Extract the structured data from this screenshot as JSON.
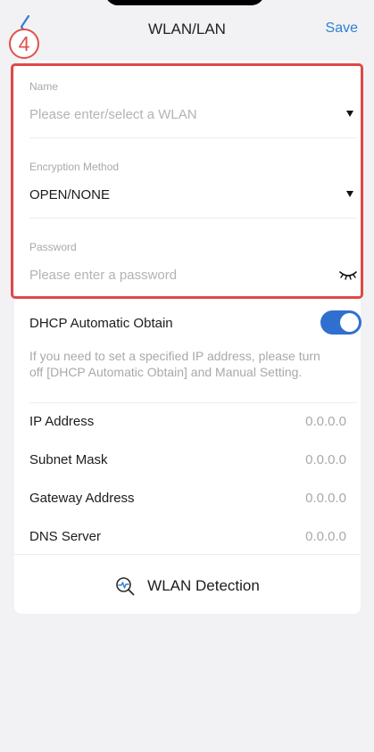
{
  "header": {
    "title": "WLAN/LAN",
    "save_label": "Save",
    "step_marker": "4"
  },
  "form": {
    "name": {
      "label": "Name",
      "placeholder": "Please enter/select a WLAN"
    },
    "encryption": {
      "label": "Encryption Method",
      "value": "OPEN/NONE"
    },
    "password": {
      "label": "Password",
      "placeholder": "Please enter a password"
    }
  },
  "dhcp": {
    "label": "DHCP Automatic Obtain",
    "enabled": true,
    "hint": "If you need to set a specified IP address, please turn off [DHCP Automatic Obtain] and Manual Setting."
  },
  "network": [
    {
      "label": "IP Address",
      "value": "0.0.0.0"
    },
    {
      "label": "Subnet Mask",
      "value": "0.0.0.0"
    },
    {
      "label": "Gateway Address",
      "value": "0.0.0.0"
    },
    {
      "label": "DNS Server",
      "value": "0.0.0.0"
    }
  ],
  "detection": {
    "label": "WLAN Detection"
  },
  "colors": {
    "accent": "#2f80d1",
    "toggle_on": "#2f6fd0",
    "highlight": "#e04848",
    "background": "#f2f2f4"
  },
  "icons": {
    "back": "chevron-left-icon",
    "caret": "caret-down-icon",
    "password_visibility": "eye-closed-icon",
    "detection": "magnifier-pulse-icon"
  }
}
